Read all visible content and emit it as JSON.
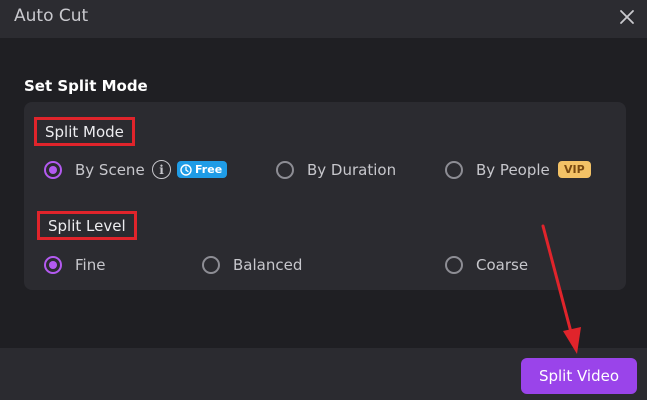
{
  "window": {
    "title": "Auto Cut",
    "close_icon": "close-icon"
  },
  "settings": {
    "section_title": "Set Split Mode",
    "split_mode": {
      "label": "Split Mode",
      "options": [
        {
          "label": "By Scene",
          "selected": true,
          "badge": "Free"
        },
        {
          "label": "By Duration",
          "selected": false
        },
        {
          "label": "By People",
          "selected": false,
          "badge": "VIP"
        }
      ]
    },
    "split_level": {
      "label": "Split Level",
      "options": [
        {
          "label": "Fine",
          "selected": true
        },
        {
          "label": "Balanced",
          "selected": false
        },
        {
          "label": "Coarse",
          "selected": false
        }
      ]
    }
  },
  "footer": {
    "split_button": "Split Video"
  },
  "colors": {
    "accent": "#b35af0",
    "button": "#9a44ea",
    "annotation": "#e0242b",
    "free_badge": "#1f9ce6",
    "vip_badge": "#f3c266"
  }
}
